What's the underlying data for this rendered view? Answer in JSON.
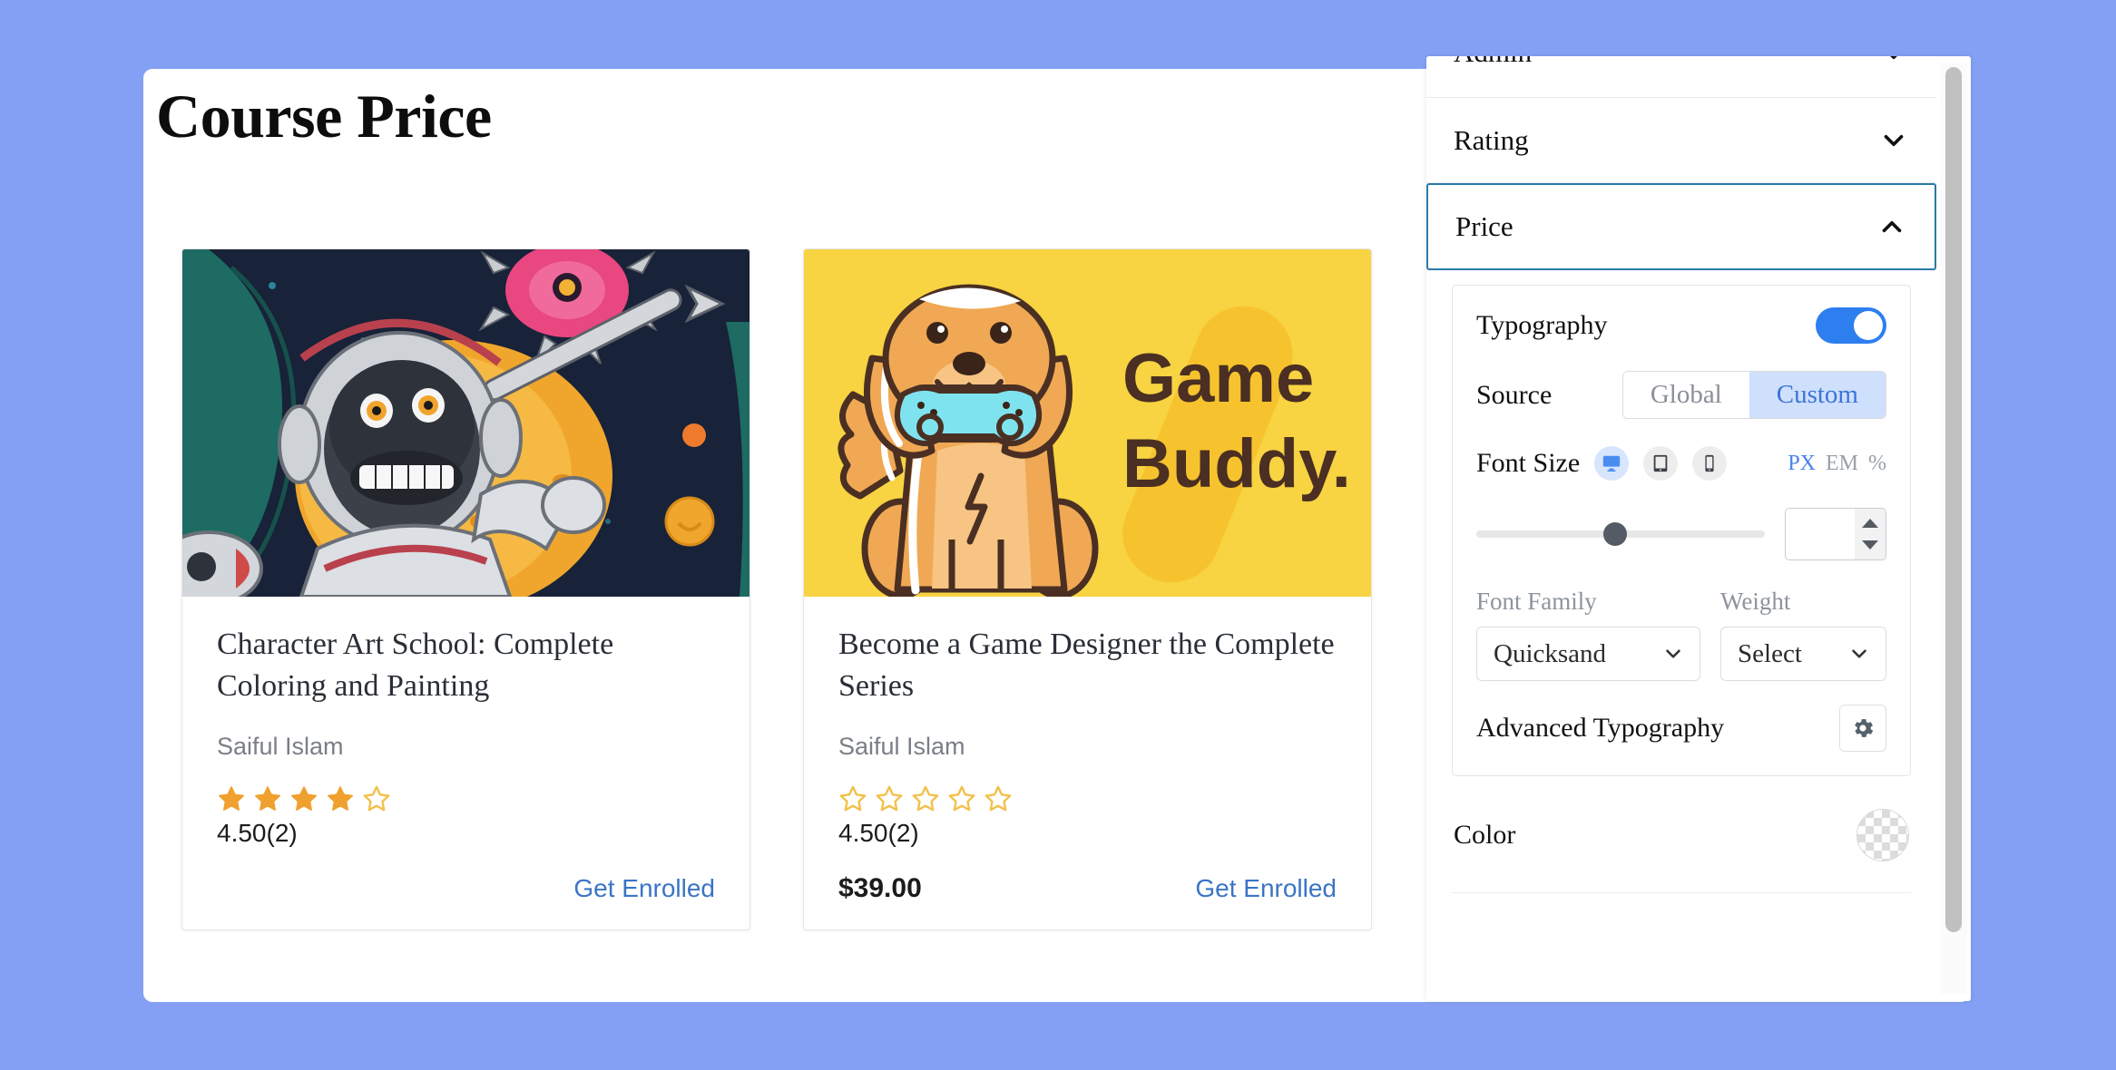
{
  "theme": {
    "background": "#84a0f5",
    "accent_blue": "#2d7ff0",
    "link_blue": "#3b74c4",
    "active_border": "#2a7aa8",
    "star_filled": "#f0a02e",
    "star_empty": "#f2c14a"
  },
  "canvas": {
    "page_title": "Course Price"
  },
  "courses": [
    {
      "title": "Character Art School: Complete Coloring and Painting",
      "author": "Saiful Islam",
      "stars_filled": 4,
      "stars_total": 5,
      "rating_text": "4.50(2)",
      "price": "",
      "enroll_label": "Get Enrolled",
      "thumb_alt": "astronaut-monkey-illustration"
    },
    {
      "title": "Become a Game Designer the Complete Series",
      "author": "Saiful Islam",
      "stars_filled": 0,
      "stars_total": 5,
      "rating_text": "4.50(2)",
      "price": "$39.00",
      "enroll_label": "Get Enrolled",
      "thumb_alt": "game-buddy-dog-illustration"
    }
  ],
  "panel": {
    "accordions": [
      {
        "label": "Admin",
        "expanded": false,
        "clipped": true
      },
      {
        "label": "Rating",
        "expanded": false,
        "clipped": false
      },
      {
        "label": "Price",
        "expanded": true,
        "clipped": false
      }
    ],
    "typography": {
      "label": "Typography",
      "enabled": true,
      "source": {
        "label": "Source",
        "options": [
          "Global",
          "Custom"
        ],
        "selected": "Custom"
      },
      "font_size": {
        "label": "Font Size",
        "devices": [
          "desktop",
          "tablet",
          "mobile"
        ],
        "active_device": "desktop",
        "units": [
          "PX",
          "EM",
          "%"
        ],
        "active_unit": "PX",
        "slider_percent": 48,
        "value": "",
        "placeholder": ""
      },
      "font_family": {
        "label": "Font Family",
        "selected": "Quicksand"
      },
      "weight": {
        "label": "Weight",
        "selected": "Select"
      },
      "advanced": {
        "label": "Advanced Typography",
        "icon": "gear-icon"
      }
    },
    "color": {
      "label": "Color",
      "value": "transparent"
    }
  }
}
